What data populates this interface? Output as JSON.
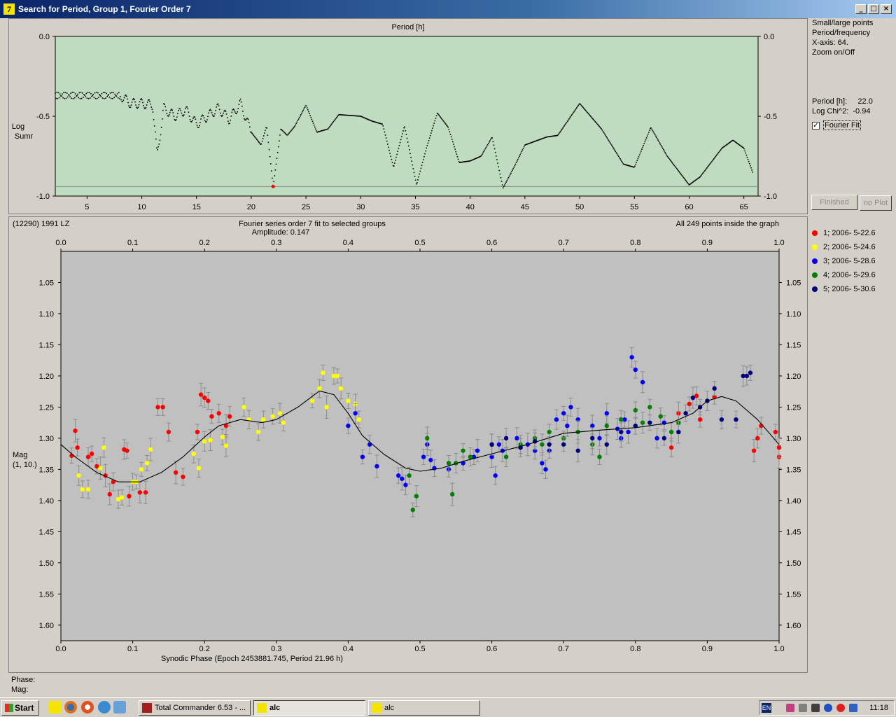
{
  "window": {
    "title": "Search for Period, Group 1, Fourier Order 7",
    "app_icon": "7"
  },
  "periodogram": {
    "title": "Period [h]",
    "ylabel_line1": "Log",
    "ylabel_line2": "Sumr",
    "x_ticks": [
      "5",
      "10",
      "15",
      "20",
      "25",
      "30",
      "35",
      "40",
      "45",
      "50",
      "55",
      "60",
      "65"
    ],
    "y_ticks": [
      "0.0",
      "-0.5",
      "-1.0"
    ],
    "xlim": [
      2.1,
      66.3
    ],
    "ylim": [
      -1.0,
      0.0
    ],
    "min_period": 22.0,
    "min_value": -0.94
  },
  "options": {
    "line1": "Small/large points",
    "line2": "Period/frequency",
    "line3": "X-axis: 64.",
    "line4": "Zoom on/Off",
    "period_label": "Period [h]:",
    "period_value": "22.0",
    "chi_label": "Log Chi^2:",
    "chi_value": "-0.94",
    "fourier_fit_label": "Fourier Fit",
    "fourier_fit_checked": true,
    "finished_button": "Finished",
    "noplot_button": "no Plot"
  },
  "lightcurve": {
    "object": "(12290) 1991 LZ",
    "title": "Fourier series order 7 fit to selected groups",
    "amplitude": "Amplitude: 0.147",
    "points_info": "All 249 points inside the graph",
    "xlabel": "Synodic Phase (Epoch 2453881.745, Period 21.96 h)",
    "ylabel_line1": "Mag",
    "ylabel_line2": "(1, 10.)",
    "x_ticks": [
      "0.0",
      "0.1",
      "0.2",
      "0.3",
      "0.4",
      "0.5",
      "0.6",
      "0.7",
      "0.8",
      "0.9",
      "1.0"
    ],
    "y_ticks": [
      "1.05",
      "1.10",
      "1.15",
      "1.20",
      "1.25",
      "1.30",
      "1.35",
      "1.40",
      "1.45",
      "1.50",
      "1.55",
      "1.60"
    ],
    "xlim": [
      0.0,
      1.0
    ],
    "ylim": [
      1.0,
      1.625
    ],
    "legend": [
      {
        "label": "1; 2006- 5-22.6",
        "color": "#ff0000"
      },
      {
        "label": "2; 2006- 5-24.6",
        "color": "#ffff00"
      },
      {
        "label": "3; 2006- 5-28.6",
        "color": "#0000ff"
      },
      {
        "label": "4; 2006- 5-29.6",
        "color": "#008000"
      },
      {
        "label": "5; 2006- 5-30.6",
        "color": "#000080"
      }
    ]
  },
  "status": {
    "phase_label": "Phase:",
    "mag_label": "Mag:"
  },
  "taskbar": {
    "start_label": "Start",
    "tasks": [
      "Total Commander 6.53 - ...",
      "alc",
      "alc"
    ],
    "lang": "EN",
    "clock": "11:18"
  },
  "chart_data": [
    {
      "type": "scatter",
      "title": "Period [h]",
      "xlabel": "Period [h]",
      "ylabel": "Log Sumr",
      "xlim": [
        2.1,
        66.3
      ],
      "ylim": [
        -1.0,
        0.0
      ],
      "curve_anchors": [
        [
          2.1,
          -0.37
        ],
        [
          8,
          -0.37
        ],
        [
          9,
          -0.42
        ],
        [
          10,
          -0.42
        ],
        [
          11,
          -0.43
        ],
        [
          11.4,
          -0.75
        ],
        [
          12,
          -0.45
        ],
        [
          13,
          -0.5
        ],
        [
          14,
          -0.46
        ],
        [
          15,
          -0.55
        ],
        [
          16,
          -0.5
        ],
        [
          17,
          -0.45
        ],
        [
          18,
          -0.52
        ],
        [
          19,
          -0.42
        ],
        [
          20,
          -0.6
        ],
        [
          20.9,
          -0.68
        ],
        [
          21.4,
          -0.56
        ],
        [
          22.0,
          -0.94
        ],
        [
          22.7,
          -0.58
        ],
        [
          23.3,
          -0.62
        ],
        [
          24,
          -0.56
        ],
        [
          25,
          -0.43
        ],
        [
          26,
          -0.6
        ],
        [
          27,
          -0.58
        ],
        [
          28,
          -0.49
        ],
        [
          30,
          -0.5
        ],
        [
          31,
          -0.53
        ],
        [
          32,
          -0.55
        ],
        [
          33,
          -0.82
        ],
        [
          34,
          -0.56
        ],
        [
          35.1,
          -0.93
        ],
        [
          36,
          -0.7
        ],
        [
          37,
          -0.48
        ],
        [
          38,
          -0.57
        ],
        [
          39,
          -0.79
        ],
        [
          40,
          -0.78
        ],
        [
          41,
          -0.75
        ],
        [
          42,
          -0.63
        ],
        [
          43,
          -0.95
        ],
        [
          44,
          -0.82
        ],
        [
          45,
          -0.68
        ],
        [
          47,
          -0.63
        ],
        [
          48,
          -0.62
        ],
        [
          50,
          -0.42
        ],
        [
          52,
          -0.58
        ],
        [
          54,
          -0.8
        ],
        [
          55,
          -0.82
        ],
        [
          56.5,
          -0.57
        ],
        [
          58,
          -0.75
        ],
        [
          60,
          -0.93
        ],
        [
          61,
          -0.88
        ],
        [
          63,
          -0.7
        ],
        [
          64,
          -0.65
        ],
        [
          65,
          -0.7
        ],
        [
          65.8,
          -0.85
        ]
      ],
      "min_marker": [
        22.0,
        -0.94
      ]
    },
    {
      "type": "scatter",
      "title": "Fourier series order 7 fit to selected groups",
      "xlabel": "Synodic Phase (Epoch 2453881.745, Period 21.96 h)",
      "ylabel": "Mag (1, 10.)",
      "xlim": [
        0.0,
        1.0
      ],
      "ylim": [
        1.0,
        1.625
      ],
      "fit_curve": [
        [
          0.0,
          1.31
        ],
        [
          0.02,
          1.33
        ],
        [
          0.05,
          1.355
        ],
        [
          0.08,
          1.37
        ],
        [
          0.11,
          1.37
        ],
        [
          0.14,
          1.355
        ],
        [
          0.17,
          1.33
        ],
        [
          0.2,
          1.298
        ],
        [
          0.22,
          1.28
        ],
        [
          0.25,
          1.27
        ],
        [
          0.28,
          1.275
        ],
        [
          0.3,
          1.27
        ],
        [
          0.33,
          1.25
        ],
        [
          0.36,
          1.224
        ],
        [
          0.38,
          1.23
        ],
        [
          0.4,
          1.26
        ],
        [
          0.42,
          1.296
        ],
        [
          0.45,
          1.326
        ],
        [
          0.48,
          1.348
        ],
        [
          0.5,
          1.353
        ],
        [
          0.53,
          1.348
        ],
        [
          0.56,
          1.337
        ],
        [
          0.6,
          1.325
        ],
        [
          0.65,
          1.31
        ],
        [
          0.7,
          1.292
        ],
        [
          0.75,
          1.287
        ],
        [
          0.8,
          1.283
        ],
        [
          0.85,
          1.275
        ],
        [
          0.88,
          1.26
        ],
        [
          0.9,
          1.24
        ],
        [
          0.92,
          1.233
        ],
        [
          0.94,
          1.24
        ],
        [
          0.97,
          1.27
        ],
        [
          1.0,
          1.31
        ]
      ],
      "series": [
        {
          "name": "1; 2006- 5-22.6",
          "color": "#ff0000",
          "points": [
            [
              0.015,
              1.328
            ],
            [
              0.02,
              1.288
            ],
            [
              0.023,
              1.315
            ],
            [
              0.038,
              1.33
            ],
            [
              0.043,
              1.325
            ],
            [
              0.05,
              1.345
            ],
            [
              0.062,
              1.36
            ],
            [
              0.068,
              1.39
            ],
            [
              0.073,
              1.37
            ],
            [
              0.095,
              1.393
            ],
            [
              0.11,
              1.387
            ],
            [
              0.118,
              1.387
            ],
            [
              0.135,
              1.25
            ],
            [
              0.142,
              1.25
            ],
            [
              0.088,
              1.318
            ],
            [
              0.092,
              1.32
            ],
            [
              0.15,
              1.29
            ],
            [
              0.16,
              1.355
            ],
            [
              0.17,
              1.362
            ],
            [
              0.19,
              1.29
            ],
            [
              0.195,
              1.23
            ],
            [
              0.2,
              1.235
            ],
            [
              0.205,
              1.24
            ],
            [
              0.21,
              1.265
            ],
            [
              0.22,
              1.26
            ],
            [
              0.23,
              1.28
            ],
            [
              0.235,
              1.265
            ],
            [
              0.85,
              1.315
            ],
            [
              0.86,
              1.26
            ],
            [
              0.875,
              1.245
            ],
            [
              0.885,
              1.232
            ],
            [
              0.89,
              1.27
            ],
            [
              0.91,
              1.234
            ],
            [
              0.965,
              1.32
            ],
            [
              0.97,
              1.3
            ],
            [
              0.975,
              1.28
            ],
            [
              0.995,
              1.29
            ],
            [
              1.0,
              1.33
            ],
            [
              1.005,
              1.315
            ]
          ]
        },
        {
          "name": "2; 2006- 5-24.6",
          "color": "#ffff00",
          "points": [
            [
              0.025,
              1.36
            ],
            [
              0.03,
              1.382
            ],
            [
              0.038,
              1.382
            ],
            [
              0.055,
              1.348
            ],
            [
              0.06,
              1.315
            ],
            [
              0.08,
              1.398
            ],
            [
              0.085,
              1.395
            ],
            [
              0.1,
              1.37
            ],
            [
              0.105,
              1.37
            ],
            [
              0.112,
              1.35
            ],
            [
              0.12,
              1.34
            ],
            [
              0.125,
              1.318
            ],
            [
              0.185,
              1.325
            ],
            [
              0.192,
              1.348
            ],
            [
              0.2,
              1.305
            ],
            [
              0.208,
              1.303
            ],
            [
              0.225,
              1.298
            ],
            [
              0.23,
              1.312
            ],
            [
              0.255,
              1.25
            ],
            [
              0.262,
              1.27
            ],
            [
              0.275,
              1.29
            ],
            [
              0.282,
              1.27
            ],
            [
              0.295,
              1.265
            ],
            [
              0.305,
              1.26
            ],
            [
              0.31,
              1.275
            ],
            [
              0.35,
              1.24
            ],
            [
              0.36,
              1.22
            ],
            [
              0.365,
              1.195
            ],
            [
              0.37,
              1.25
            ],
            [
              0.38,
              1.2
            ],
            [
              0.385,
              1.2
            ],
            [
              0.39,
              1.22
            ],
            [
              0.4,
              1.24
            ],
            [
              0.41,
              1.245
            ],
            [
              0.415,
              1.27
            ]
          ]
        },
        {
          "name": "3; 2006- 5-28.6",
          "color": "#0000ff",
          "points": [
            [
              0.4,
              1.28
            ],
            [
              0.41,
              1.26
            ],
            [
              0.42,
              1.33
            ],
            [
              0.43,
              1.31
            ],
            [
              0.44,
              1.345
            ],
            [
              0.47,
              1.36
            ],
            [
              0.475,
              1.365
            ],
            [
              0.48,
              1.375
            ],
            [
              0.505,
              1.33
            ],
            [
              0.51,
              1.31
            ],
            [
              0.515,
              1.335
            ],
            [
              0.52,
              1.348
            ],
            [
              0.54,
              1.35
            ],
            [
              0.56,
              1.34
            ],
            [
              0.575,
              1.33
            ],
            [
              0.58,
              1.32
            ],
            [
              0.6,
              1.33
            ],
            [
              0.605,
              1.36
            ],
            [
              0.61,
              1.31
            ],
            [
              0.615,
              1.32
            ],
            [
              0.635,
              1.3
            ],
            [
              0.65,
              1.31
            ],
            [
              0.66,
              1.32
            ],
            [
              0.67,
              1.34
            ],
            [
              0.675,
              1.35
            ],
            [
              0.68,
              1.32
            ],
            [
              0.69,
              1.27
            ],
            [
              0.7,
              1.26
            ],
            [
              0.705,
              1.28
            ],
            [
              0.71,
              1.25
            ],
            [
              0.72,
              1.27
            ],
            [
              0.74,
              1.28
            ],
            [
              0.75,
              1.3
            ],
            [
              0.76,
              1.26
            ],
            [
              0.775,
              1.285
            ],
            [
              0.78,
              1.3
            ],
            [
              0.785,
              1.27
            ],
            [
              0.79,
              1.29
            ],
            [
              0.795,
              1.17
            ],
            [
              0.8,
              1.19
            ],
            [
              0.81,
              1.21
            ],
            [
              0.83,
              1.3
            ],
            [
              0.84,
              1.275
            ]
          ]
        },
        {
          "name": "4; 2006- 5-29.6",
          "color": "#008000",
          "points": [
            [
              0.485,
              1.36
            ],
            [
              0.49,
              1.415
            ],
            [
              0.495,
              1.393
            ],
            [
              0.51,
              1.3
            ],
            [
              0.54,
              1.34
            ],
            [
              0.545,
              1.39
            ],
            [
              0.55,
              1.34
            ],
            [
              0.56,
              1.32
            ],
            [
              0.57,
              1.33
            ],
            [
              0.6,
              1.31
            ],
            [
              0.62,
              1.33
            ],
            [
              0.64,
              1.31
            ],
            [
              0.66,
              1.3
            ],
            [
              0.67,
              1.31
            ],
            [
              0.68,
              1.29
            ],
            [
              0.7,
              1.3
            ],
            [
              0.72,
              1.29
            ],
            [
              0.74,
              1.31
            ],
            [
              0.75,
              1.33
            ],
            [
              0.76,
              1.28
            ],
            [
              0.78,
              1.27
            ],
            [
              0.8,
              1.255
            ],
            [
              0.81,
              1.275
            ],
            [
              0.82,
              1.25
            ],
            [
              0.835,
              1.265
            ],
            [
              0.85,
              1.29
            ],
            [
              0.86,
              1.275
            ]
          ]
        },
        {
          "name": "5; 2006- 5-30.6",
          "color": "#000080",
          "points": [
            [
              0.6,
              1.31
            ],
            [
              0.62,
              1.3
            ],
            [
              0.64,
              1.315
            ],
            [
              0.66,
              1.305
            ],
            [
              0.68,
              1.31
            ],
            [
              0.7,
              1.31
            ],
            [
              0.72,
              1.32
            ],
            [
              0.74,
              1.3
            ],
            [
              0.76,
              1.31
            ],
            [
              0.78,
              1.29
            ],
            [
              0.8,
              1.28
            ],
            [
              0.82,
              1.275
            ],
            [
              0.84,
              1.3
            ],
            [
              0.86,
              1.29
            ],
            [
              0.87,
              1.26
            ],
            [
              0.88,
              1.235
            ],
            [
              0.89,
              1.25
            ],
            [
              0.9,
              1.24
            ],
            [
              0.91,
              1.22
            ],
            [
              0.92,
              1.27
            ],
            [
              0.94,
              1.27
            ],
            [
              0.95,
              1.2
            ],
            [
              0.955,
              1.2
            ],
            [
              0.96,
              1.195
            ]
          ]
        }
      ]
    }
  ]
}
